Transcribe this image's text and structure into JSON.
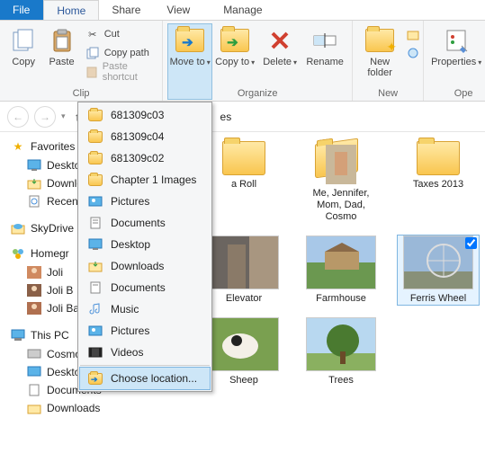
{
  "tabs": {
    "file": "File",
    "home": "Home",
    "share": "Share",
    "view": "View",
    "manage": "Manage"
  },
  "ribbon": {
    "clipboard": {
      "label": "Clip",
      "copy": "Copy",
      "paste": "Paste",
      "cut": "Cut",
      "copy_path": "Copy path",
      "paste_shortcut": "Paste shortcut"
    },
    "organize": {
      "label": "Organize",
      "move_to": "Move to",
      "copy_to": "Copy to",
      "delete": "Delete",
      "rename": "Rename"
    },
    "new": {
      "label": "New",
      "new_folder": "New folder"
    },
    "open": {
      "label": "Ope",
      "properties": "Properties"
    }
  },
  "dropdown": {
    "items": [
      "681309c03",
      "681309c04",
      "681309c02",
      "Chapter 1 Images",
      "Pictures",
      "Documents",
      "Desktop",
      "Downloads",
      "Documents",
      "Music",
      "Pictures",
      "Videos"
    ],
    "choose": "Choose location..."
  },
  "breadcrumb_tail": "es",
  "sidebar": {
    "favorites": {
      "label": "Favorites",
      "items": [
        "Desktop",
        "Downlo",
        "Recent"
      ]
    },
    "skydrive": "SkyDrive",
    "homegroup": {
      "label": "Homegr",
      "items": [
        "Joli",
        "Joli B",
        "Joli Bal"
      ]
    },
    "thispc": {
      "label": "This PC",
      "items": [
        "Cosmo (hplaptop)",
        "Desktop",
        "Documents",
        "Downloads"
      ]
    }
  },
  "content": {
    "row1": [
      "a Roll",
      "Me, Jennifer, Mom, Dad, Cosmo",
      "Taxes 2013"
    ],
    "row2": [
      "Elevator",
      "Farmhouse",
      "Ferris Wheel"
    ],
    "row3": [
      "Sheep",
      "Trees"
    ]
  }
}
